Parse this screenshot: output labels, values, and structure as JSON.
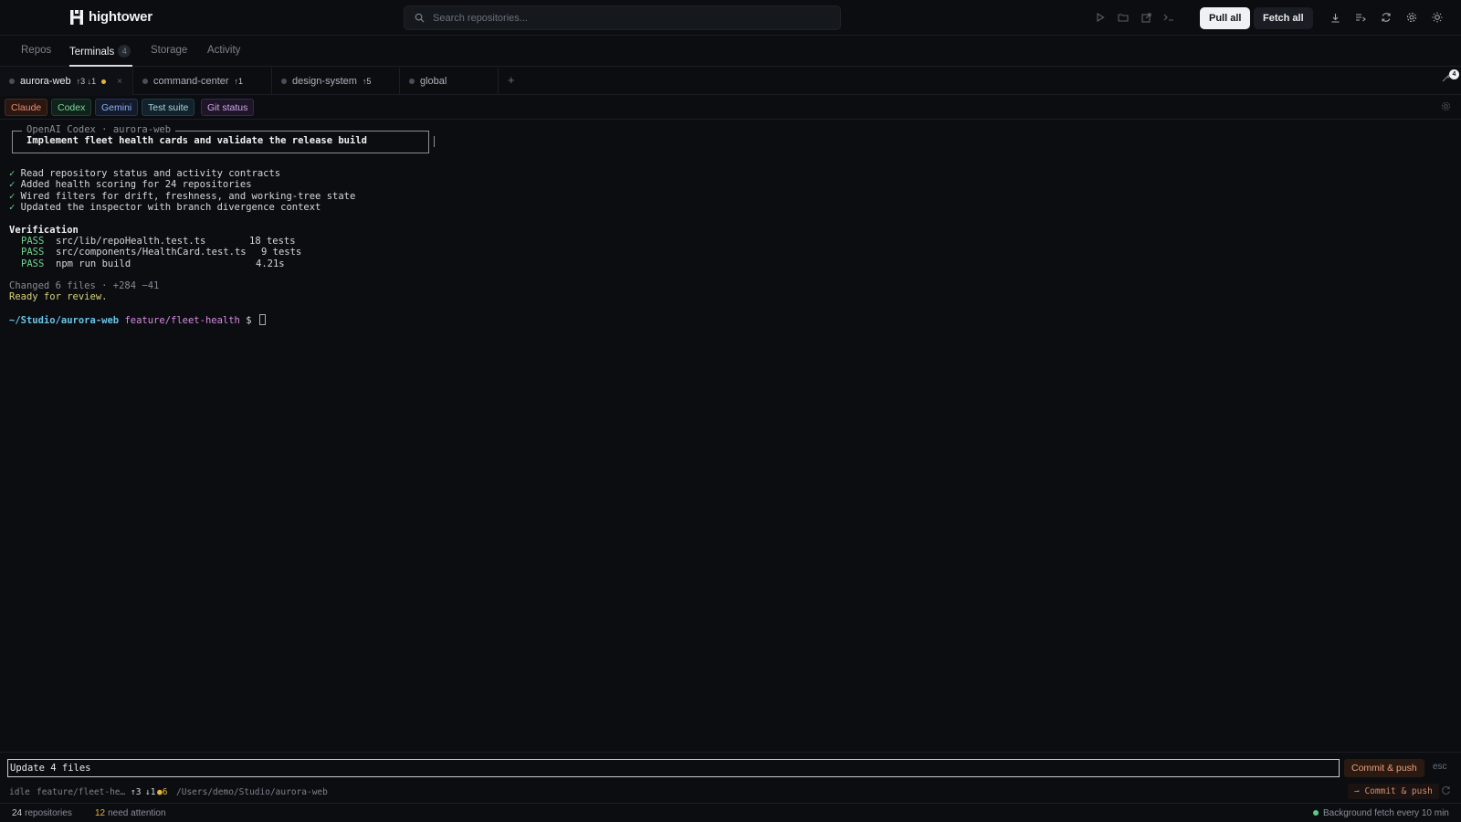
{
  "app": {
    "name": "hightower",
    "search_placeholder": "Search repositories...",
    "pull_all_label": "Pull all",
    "fetch_all_label": "Fetch all"
  },
  "nav": {
    "tabs": [
      {
        "label": "Repos"
      },
      {
        "label": "Terminals",
        "badge": "4",
        "active": true
      },
      {
        "label": "Storage"
      },
      {
        "label": "Activity"
      }
    ]
  },
  "terminal_tabs": [
    {
      "name": "aurora-web",
      "sync": "↑3 ↓1",
      "modified": true,
      "active": true,
      "close": "×"
    },
    {
      "name": "command-center",
      "sync": "↑1"
    },
    {
      "name": "design-system",
      "sync": "↑5"
    },
    {
      "name": "global",
      "sync": ""
    }
  ],
  "add_tab": "+",
  "corner_badge": "4",
  "agents": [
    "Claude",
    "Codex",
    "Gemini",
    "Test suite",
    "Git status"
  ],
  "terminal": {
    "box_title": "OpenAI Codex · aurora-web",
    "box_command": "Implement fleet health cards and validate the release build",
    "checklist": [
      "Read repository status and activity contracts",
      "Added health scoring for 24 repositories",
      "Wired filters for drift, freshness, and working-tree state",
      "Updated the inspector with branch divergence context"
    ],
    "check_mark": "✓",
    "verification_heading": "Verification",
    "verification": [
      {
        "status": "PASS",
        "target": "src/lib/repoHealth.test.ts",
        "result": "18 tests"
      },
      {
        "status": "PASS",
        "target": "src/components/HealthCard.test.ts",
        "result": "9 tests"
      },
      {
        "status": "PASS",
        "target": "npm run build",
        "result": "4.21s"
      }
    ],
    "changed_summary": "Changed 6 files · +284 −41",
    "ready": "Ready for review.",
    "prompt_path": "~/Studio/aurora-web",
    "prompt_branch": "feature/fleet-health",
    "prompt_symbol": "$"
  },
  "commit": {
    "message": "Update 4 files",
    "button": "Commit & push",
    "esc": "esc"
  },
  "status_line": {
    "state": "idle",
    "branch": "feature/fleet-he…",
    "ahead": "↑3",
    "behind": "↓1",
    "changes": "●6",
    "path": "/Users/demo/Studio/aurora-web",
    "commit_button": "⇀ Commit & push"
  },
  "footer": {
    "repo_count": "24",
    "repo_label": "repositories",
    "attention_count": "12",
    "attention_label": "need attention",
    "background_fetch": "Background fetch every 10 min"
  },
  "colors": {
    "background": "#0b0d11",
    "accent_green": "#73d28f",
    "modified_dot": "#e5b53a",
    "prompt_path": "#6cc4e8",
    "prompt_branch": "#d58ee0"
  }
}
